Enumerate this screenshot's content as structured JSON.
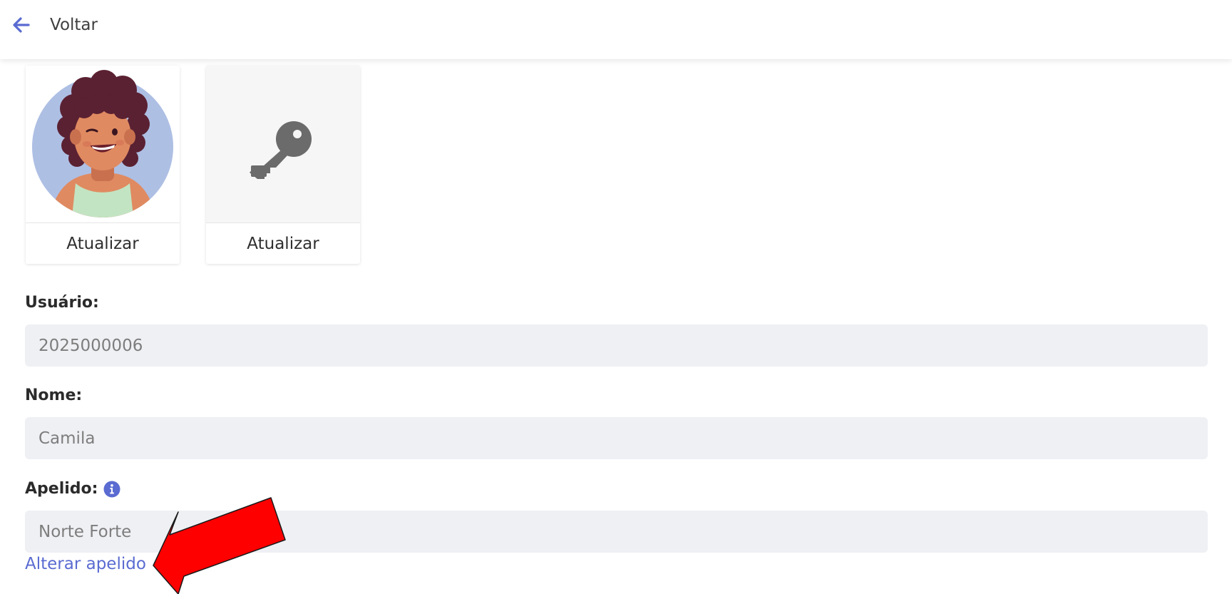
{
  "header": {
    "back_label": "Voltar",
    "accent_color": "#5a6bd1"
  },
  "cards": {
    "avatar_button": "Atualizar",
    "password_button": "Atualizar",
    "avatar_icon": "avatar-illustration",
    "password_icon": "key-icon"
  },
  "fields": {
    "usuario": {
      "label": "Usuário:",
      "value": "2025000006"
    },
    "nome": {
      "label": "Nome:",
      "value": "Camila"
    },
    "apelido": {
      "label": "Apelido:",
      "value": "Norte Forte",
      "info_icon": "info-icon"
    }
  },
  "links": {
    "change_nickname": "Alterar apelido"
  },
  "annotation": {
    "arrow_color": "#ff0000"
  }
}
